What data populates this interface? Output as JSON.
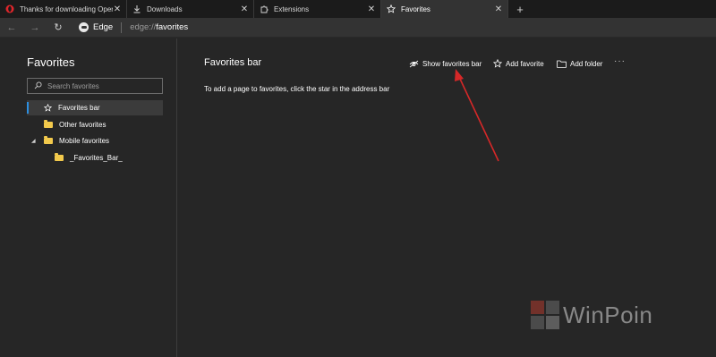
{
  "tabs": [
    {
      "label": "Thanks for downloading Opera",
      "icon": "opera-icon",
      "close": "✕"
    },
    {
      "label": "Downloads",
      "icon": "download-icon",
      "close": "✕"
    },
    {
      "label": "Extensions",
      "icon": "puzzle-icon",
      "close": "✕"
    },
    {
      "label": "Favorites",
      "icon": "star-icon",
      "close": "✕"
    }
  ],
  "new_tab": "+",
  "toolbar": {
    "back": "←",
    "forward": "→",
    "refresh": "↻",
    "browser_name": "Edge",
    "url_scheme": "edge://",
    "url_host": "favorites"
  },
  "sidebar": {
    "title": "Favorites",
    "search_placeholder": "Search favorites",
    "items": [
      {
        "label": "Favorites bar",
        "icon": "star-icon"
      },
      {
        "label": "Other favorites",
        "icon": "folder-icon"
      },
      {
        "label": "Mobile favorites",
        "icon": "folder-icon",
        "expander": "◢"
      },
      {
        "label": "_Favorites_Bar_",
        "icon": "folder-icon"
      }
    ]
  },
  "main": {
    "title": "Favorites bar",
    "actions": {
      "show_bar": "Show favorites bar",
      "add_favorite": "Add favorite",
      "add_folder": "Add folder",
      "more": "···"
    },
    "hint": "To add a page to favorites, click the star in the address bar"
  },
  "watermark": {
    "text": "WinPoin"
  },
  "colors": {
    "background": "#262626",
    "tabstrip": "#1b1b1b",
    "selection_accent": "#2c8fe0",
    "folder": "#f2c94c",
    "annotation_arrow": "#d62828"
  }
}
